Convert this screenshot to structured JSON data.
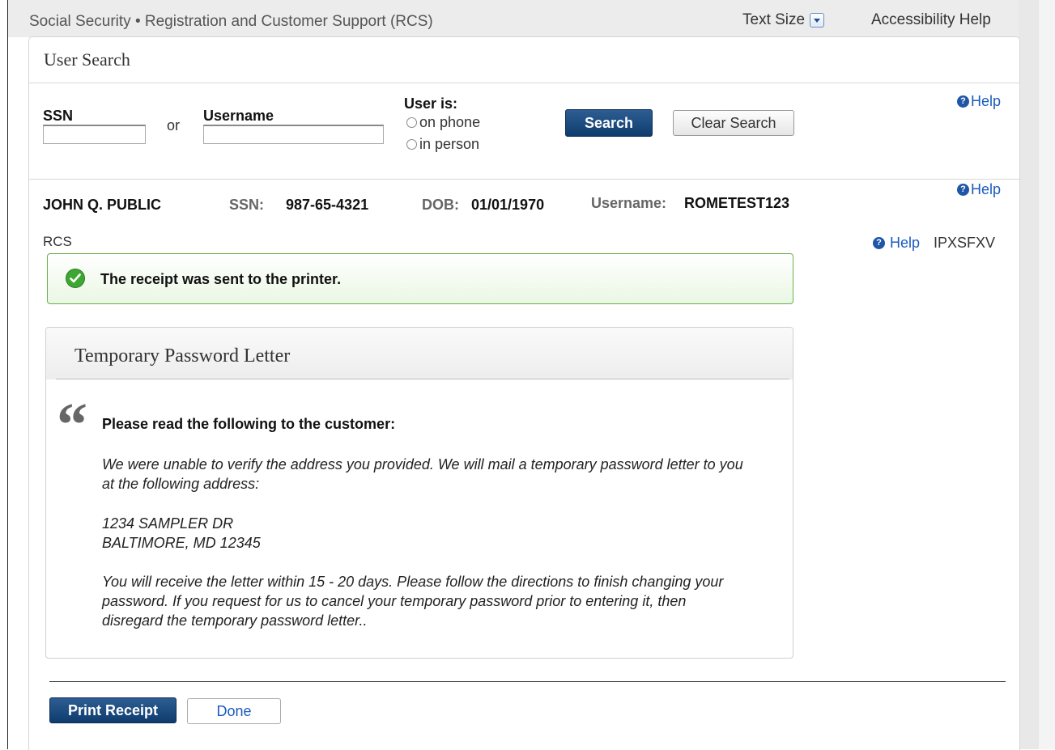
{
  "header": {
    "app_title": "Social Security • Registration and Customer Support (RCS)",
    "text_size_label": "Text Size",
    "accessibility_label": "Accessibility Help"
  },
  "page": {
    "title": "User Search"
  },
  "search": {
    "ssn_label": "SSN",
    "ssn_value": "",
    "or_label": "or",
    "username_label": "Username",
    "username_value": "",
    "user_is_label": "User is:",
    "radio_phone": "on phone",
    "radio_person": "in person",
    "search_button": "Search",
    "clear_button": "Clear Search",
    "help_label": "Help"
  },
  "user": {
    "name": "JOHN Q. PUBLIC",
    "ssn_key": "SSN:",
    "ssn_value": "987-65-4321",
    "dob_key": "DOB:",
    "dob_value": "01/01/1970",
    "username_key": "Username:",
    "username_value": "ROMETEST123",
    "help_label": "Help"
  },
  "section": {
    "label": "RCS",
    "help_label": "Help",
    "screen_code": "IPXSFXV"
  },
  "alert": {
    "message": "The receipt was sent to the printer.",
    "color": "#3ea733"
  },
  "letter": {
    "title": "Temporary Password Letter",
    "instruction": "Please read the following to the customer:",
    "paragraph1": "We were unable to verify the address you provided. We will mail a temporary password letter to you at the following address:",
    "address_line1": "1234 SAMPLER DR",
    "address_line2": "BALTIMORE, MD 12345",
    "paragraph2": "You will receive the letter within 15 - 20  days. Please follow the directions to finish changing your password. If you request for us to cancel your temporary password prior to entering it, then disregard the temporary password letter.."
  },
  "actions": {
    "print_button": "Print Receipt",
    "done_button": "Done"
  },
  "colors": {
    "primary": "#0f3c6e",
    "link": "#1a5bbd"
  }
}
